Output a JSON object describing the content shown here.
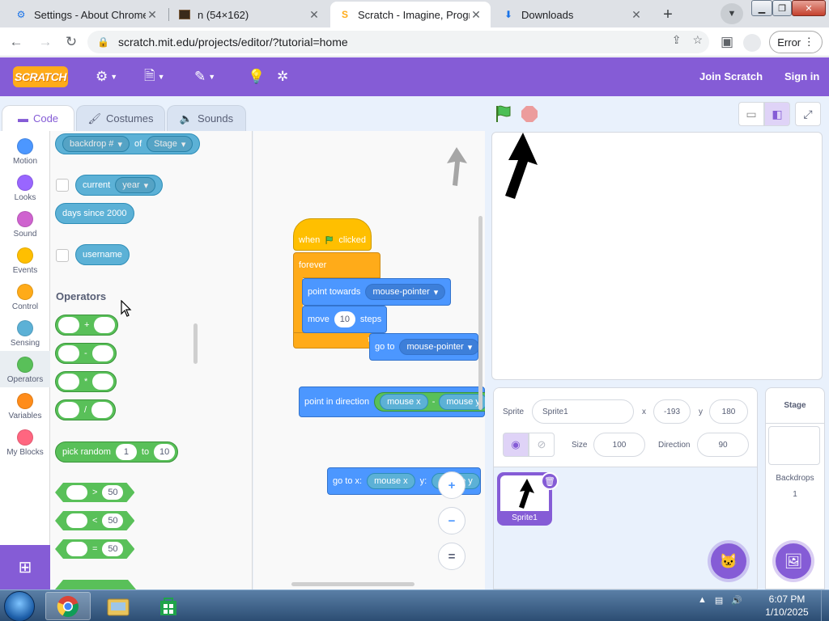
{
  "browser": {
    "tabs": [
      {
        "title": "Settings - About Chrome",
        "active": false
      },
      {
        "title": "n (54×162)",
        "active": false
      },
      {
        "title": "Scratch - Imagine, Progra",
        "active": true
      },
      {
        "title": "Downloads",
        "active": false
      }
    ],
    "url": "scratch.mit.edu/projects/editor/?tutorial=home",
    "error_label": "Error"
  },
  "menubar": {
    "logo": "SCRATCH",
    "join": "Join Scratch",
    "signin": "Sign in"
  },
  "editor_tabs": {
    "code": "Code",
    "costumes": "Costumes",
    "sounds": "Sounds"
  },
  "categories": [
    {
      "label": "Motion",
      "color": "#4c97ff"
    },
    {
      "label": "Looks",
      "color": "#9966ff"
    },
    {
      "label": "Sound",
      "color": "#cf63cf"
    },
    {
      "label": "Events",
      "color": "#ffbf00"
    },
    {
      "label": "Control",
      "color": "#ffab19"
    },
    {
      "label": "Sensing",
      "color": "#5cb1d6"
    },
    {
      "label": "Operators",
      "color": "#59c059"
    },
    {
      "label": "Variables",
      "color": "#ff8c1a"
    },
    {
      "label": "My Blocks",
      "color": "#ff6680"
    }
  ],
  "selected_category": "Operators",
  "palette": {
    "backdrop_block": {
      "menu": "backdrop #",
      "of": "of",
      "target": "Stage"
    },
    "current_block": {
      "label": "current",
      "menu": "year"
    },
    "days_since": "days since 2000",
    "username": "username",
    "operators_heading": "Operators",
    "add_op": "+",
    "sub_op": "-",
    "mul_op": "*",
    "div_op": "/",
    "pick_random": {
      "label": "pick random",
      "from": "1",
      "to_label": "to",
      "to": "10"
    },
    "gt": {
      "op": ">",
      "value": "50"
    },
    "lt": {
      "op": "<",
      "value": "50"
    },
    "eq": {
      "op": "=",
      "value": "50"
    }
  },
  "script": {
    "when_clicked": {
      "when": "when",
      "clicked": "clicked"
    },
    "forever": "forever",
    "point_towards": {
      "label": "point towards",
      "target": "mouse-pointer"
    },
    "move": {
      "label": "move",
      "steps_value": "10",
      "steps": "steps"
    },
    "go_to": {
      "label": "go to",
      "target": "mouse-pointer"
    },
    "point_in_direction": {
      "label": "point in direction",
      "left": "mouse x",
      "op": "-",
      "right": "mouse y"
    },
    "go_to_xy": {
      "label": "go to x:",
      "x": "mouse x",
      "y_label": "y:",
      "y": "mouse y"
    }
  },
  "zoom": {
    "in": "+",
    "out": "−",
    "reset": "="
  },
  "sprite_info": {
    "sprite_label": "Sprite",
    "sprite_name": "Sprite1",
    "x_label": "x",
    "x": "-193",
    "y_label": "y",
    "y": "180",
    "show_label": "Show",
    "size_label": "Size",
    "size": "100",
    "direction_label": "Direction",
    "direction": "90"
  },
  "sprite_list": [
    {
      "name": "Sprite1",
      "selected": true
    }
  ],
  "stage_panel": {
    "title": "Stage",
    "backdrops_label": "Backdrops",
    "backdrops_count": "1"
  },
  "taskbar": {
    "time": "6:07 PM",
    "date": "1/10/2025"
  },
  "colors": {
    "scratch_purple": "#855cd6",
    "operators_green": "#59c059",
    "sensing_blue": "#5cb1d6",
    "motion_blue": "#4c97ff",
    "control_orange": "#ffab19",
    "events_yellow": "#ffbf00"
  }
}
